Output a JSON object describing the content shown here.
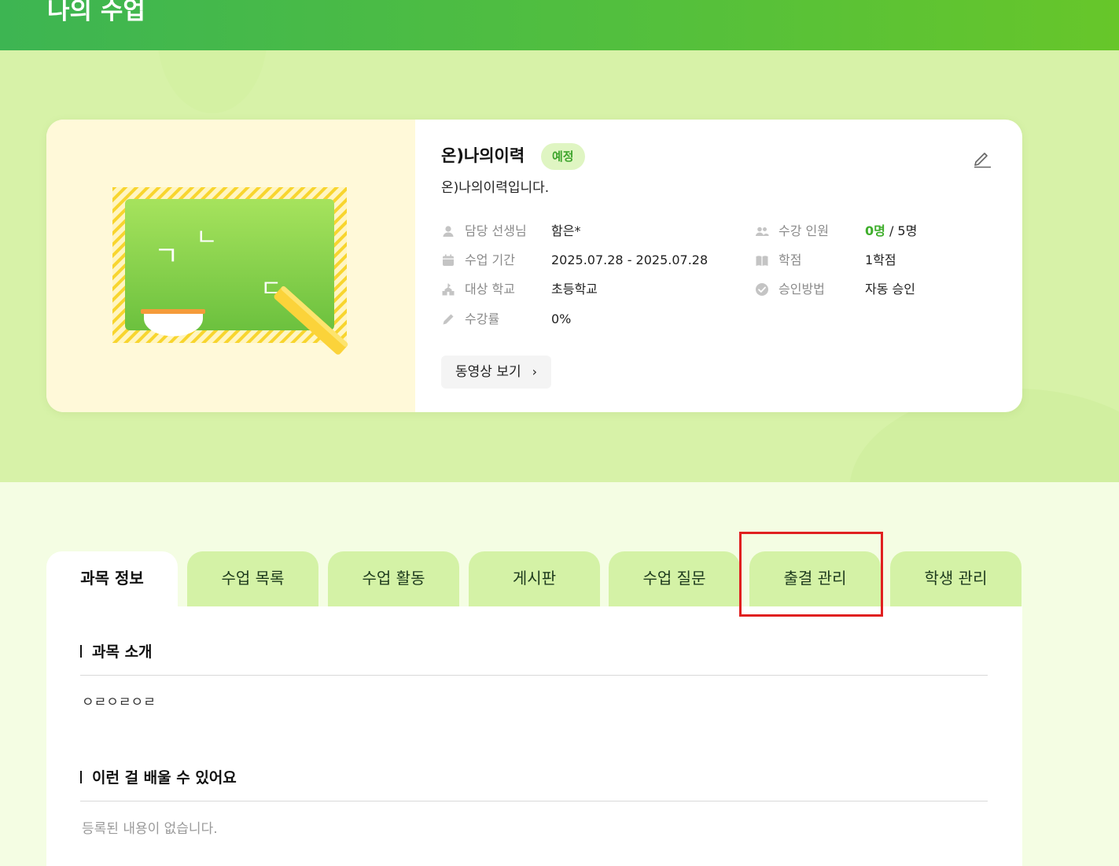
{
  "header": {
    "title": "나의 수업"
  },
  "course": {
    "title": "온)나의이력",
    "status_badge": "예정",
    "description": "온)나의이력입니다.",
    "details_left": [
      {
        "icon": "person-icon",
        "label": "담당 선생님",
        "value": "함은*"
      },
      {
        "icon": "calendar-icon",
        "label": "수업 기간",
        "value": "2025.07.28 - 2025.07.28"
      },
      {
        "icon": "school-icon",
        "label": "대상 학교",
        "value": "초등학교"
      },
      {
        "icon": "pencil-icon",
        "label": "수강률",
        "value": "0%"
      }
    ],
    "details_right": [
      {
        "icon": "users-icon",
        "label": "수강 인원",
        "value_highlight": "0명",
        "value_rest": " / 5명"
      },
      {
        "icon": "book-icon",
        "label": "학점",
        "value": "1학점"
      },
      {
        "icon": "check-circle-icon",
        "label": "승인방법",
        "value": "자동 승인"
      }
    ],
    "video_button": "동영상 보기",
    "thumbnail_letters": [
      "ㄱ",
      "ㄴ",
      "ㄷ"
    ]
  },
  "tabs": [
    {
      "label": "과목 정보",
      "active": true
    },
    {
      "label": "수업 목록",
      "active": false
    },
    {
      "label": "수업 활동",
      "active": false
    },
    {
      "label": "게시판",
      "active": false
    },
    {
      "label": "수업 질문",
      "active": false
    },
    {
      "label": "출결 관리",
      "active": false
    },
    {
      "label": "학생 관리",
      "active": false
    }
  ],
  "sections": {
    "intro": {
      "title": "과목 소개",
      "body": "ㅇㄹㅇㄹㅇㄹ"
    },
    "learn": {
      "title": "이런 걸 배울 수 있어요",
      "body": "등록된 내용이 없습니다."
    }
  },
  "colors": {
    "accent": "#3fae2c",
    "header_start": "#3db552",
    "header_end": "#67c62a",
    "highlight": "#e02020"
  }
}
